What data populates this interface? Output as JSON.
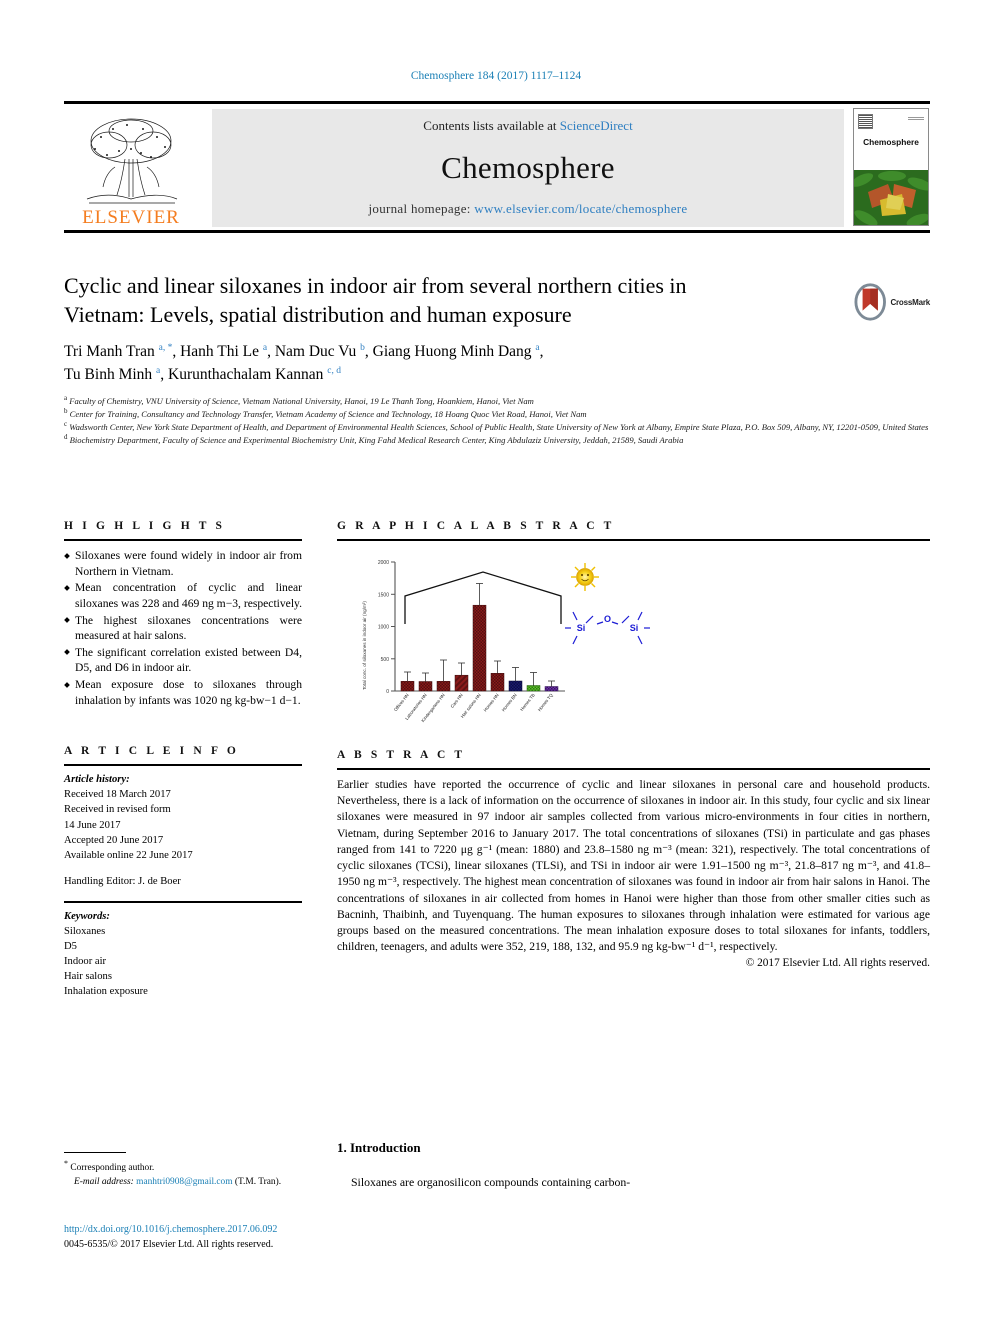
{
  "running_head": "Chemosphere 184 (2017) 1117–1124",
  "masthead": {
    "contents_prefix": "Contents lists available at ",
    "sciencedirect": "ScienceDirect",
    "journal": "Chemosphere",
    "homepage_prefix": "journal homepage: ",
    "homepage_url": "www.elsevier.com/locate/chemosphere",
    "publisher": "ELSEVIER",
    "cover_title": "Chemosphere"
  },
  "article": {
    "title": "Cyclic and linear siloxanes in indoor air from several northern cities in Vietnam: Levels, spatial distribution and human exposure",
    "crossmark_label": "CrossMark",
    "authors": [
      {
        "name": "Tri Manh Tran",
        "sup": "a, *"
      },
      {
        "name": "Hanh Thi Le",
        "sup": "a"
      },
      {
        "name": "Nam Duc Vu",
        "sup": "b"
      },
      {
        "name": "Giang Huong Minh Dang",
        "sup": "a"
      },
      {
        "name": "Tu Binh Minh",
        "sup": "a"
      },
      {
        "name": "Kurunthachalam Kannan",
        "sup": "c, d"
      }
    ],
    "affiliations": [
      {
        "mark": "a",
        "text": "Faculty of Chemistry, VNU University of Science, Vietnam National University, Hanoi, 19 Le Thanh Tong, Hoankiem, Hanoi, Viet Nam"
      },
      {
        "mark": "b",
        "text": "Center for Training, Consultancy and Technology Transfer, Vietnam Academy of Science and Technology, 18 Hoang Quoc Viet Road, Hanoi, Viet Nam"
      },
      {
        "mark": "c",
        "text": "Wadsworth Center, New York State Department of Health, and Department of Environmental Health Sciences, School of Public Health, State University of New York at Albany, Empire State Plaza, P.O. Box 509, Albany, NY, 12201-0509, United States"
      },
      {
        "mark": "d",
        "text": "Biochemistry Department, Faculty of Science and Experimental Biochemistry Unit, King Fahd Medical Research Center, King Abdulaziz University, Jeddah, 21589, Saudi Arabia"
      }
    ]
  },
  "highlights": {
    "heading": "H I G H L I G H T S",
    "items": [
      "Siloxanes were found widely in indoor air from Northern in Vietnam.",
      "Mean concentration of cyclic and linear siloxanes was 228 and 469 ng m−3, respectively.",
      "The highest siloxanes concentrations were measured at hair salons.",
      "The significant correlation existed between D4, D5, and D6 in indoor air.",
      "Mean exposure dose to siloxanes through inhalation by infants was 1020 ng kg-bw−1 d−1."
    ]
  },
  "graphical_abstract": {
    "heading": "G R A P H I C A L  A B S T R A C T"
  },
  "chart_data": {
    "type": "bar",
    "title": "",
    "ylabel": "Total conc. of siloxanes in indoor air (ng/m³)",
    "xlabel": "",
    "ylim": [
      0,
      2000
    ],
    "yticks": [
      0,
      500,
      1000,
      1500,
      2000
    ],
    "categories": [
      "Offices HN",
      "Laboratories HN",
      "Kindergartens HN",
      "Cars HN",
      "Hair salons HN",
      "Homes HN",
      "Homes BN",
      "Homes TB",
      "Homes TQ"
    ],
    "values": [
      150,
      148,
      150,
      245,
      1330,
      275,
      155,
      85,
      70
    ],
    "errors": [
      55,
      45,
      150,
      90,
      300,
      85,
      100,
      70,
      35
    ],
    "colors": [
      "#8B1A1A",
      "#8B1A1A",
      "#8B1A1A",
      "#8B1A1A",
      "#8B1A1A",
      "#8B1A1A",
      "#191970",
      "#4CAF23",
      "#5B2D8E"
    ],
    "grid": false,
    "legend": "none",
    "annotations": [
      "house outline",
      "sun icon",
      "Si–O–Si siloxane molecule"
    ],
    "molecule": {
      "left_atom": "Si",
      "bridge_atom": "O",
      "right_atom": "Si",
      "color": "#1b1bd4"
    }
  },
  "article_info": {
    "heading": "A R T I C L E  I N F O",
    "history_label": "Article history:",
    "history": [
      "Received 18 March 2017",
      "Received in revised form",
      "14 June 2017",
      "Accepted 20 June 2017",
      "Available online 22 June 2017"
    ],
    "handling_editor": "Handling Editor: J. de Boer",
    "keywords_label": "Keywords:",
    "keywords": [
      "Siloxanes",
      "D5",
      "Indoor air",
      "Hair salons",
      "Inhalation exposure"
    ]
  },
  "abstract": {
    "heading": "A B S T R A C T",
    "text": "Earlier studies have reported the occurrence of cyclic and linear siloxanes in personal care and household products. Nevertheless, there is a lack of information on the occurrence of siloxanes in indoor air. In this study, four cyclic and six linear siloxanes were measured in 97 indoor air samples collected from various micro-environments in four cities in northern, Vietnam, during September 2016 to January 2017. The total concentrations of siloxanes (TSi) in particulate and gas phases ranged from 141 to 7220 μg g⁻¹ (mean: 1880) and 23.8–1580 ng m⁻³ (mean: 321), respectively. The total concentrations of cyclic siloxanes (TCSi), linear siloxanes (TLSi), and TSi in indoor air were 1.91–1500 ng m⁻³, 21.8–817 ng m⁻³, and 41.8–1950 ng m⁻³, respectively. The highest mean concentration of siloxanes was found in indoor air from hair salons in Hanoi. The concentrations of siloxanes in air collected from homes in Hanoi were higher than those from other smaller cities such as Bacninh, Thaibinh, and Tuyenquang. The human exposures to siloxanes through inhalation were estimated for various age groups based on the measured concentrations. The mean inhalation exposure doses to total siloxanes for infants, toddlers, children, teenagers, and adults were 352, 219, 188, 132, and 95.9 ng kg-bw⁻¹ d⁻¹, respectively.",
    "copyright": "© 2017 Elsevier Ltd. All rights reserved."
  },
  "footer": {
    "corresponding": "Corresponding author.",
    "email_label": "E-mail address:",
    "email": "manhtri0908@gmail.com",
    "email_owner": "(T.M. Tran).",
    "doi": "http://dx.doi.org/10.1016/j.chemosphere.2017.06.092",
    "issn_line": "0045-6535/© 2017 Elsevier Ltd. All rights reserved."
  },
  "introduction": {
    "heading": "1. Introduction",
    "first_line": "Siloxanes are organosilicon compounds containing carbon-"
  }
}
